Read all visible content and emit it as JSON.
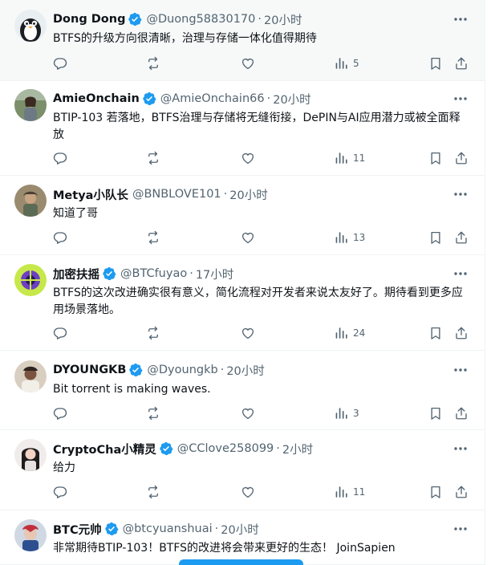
{
  "replies": [
    {
      "name": "Dong Dong",
      "verified": true,
      "handle": "@Duong58830170",
      "time": "20小时",
      "text": "BTFS的升级方向很清晰，治理与存储一体化值得期待",
      "views": "5",
      "highlighted": true
    },
    {
      "name": "AmieOnchain",
      "verified": true,
      "handle": "@AmieOnchain66",
      "time": "20小时",
      "text": "BTIP-103 若落地，BTFS治理与存储将无缝衔接，DePIN与AI应用潜力或被全面释放",
      "views": "11",
      "highlighted": false
    },
    {
      "name": "Metya小队长",
      "verified": false,
      "handle": "@BNBLOVE101",
      "time": "20小时",
      "text": "知道了哥",
      "views": "13",
      "highlighted": false
    },
    {
      "name": "加密扶摇",
      "verified": true,
      "handle": "@BTCfuyao",
      "time": "17小时",
      "text": "BTFS的这次改进确实很有意义，简化流程对开发者来说太友好了。期待看到更多应用场景落地。",
      "views": "24",
      "highlighted": false
    },
    {
      "name": "DYOUNGKB",
      "verified": true,
      "handle": "@Dyoungkb",
      "time": "20小时",
      "text": "Bit torrent is making waves.",
      "views": "3",
      "highlighted": false
    },
    {
      "name": "CryptoCha小精灵",
      "verified": true,
      "handle": "@CClove258099",
      "time": "2小时",
      "text": "给力",
      "views": "11",
      "highlighted": false
    },
    {
      "name": "BTC元帅",
      "verified": true,
      "handle": "@btcyuanshuai",
      "time": "20小时",
      "text": "非常期待BTIP-103！BTFS的改进将会带来更好的生态！ JoinSapien",
      "views": "",
      "highlighted": false
    }
  ],
  "colors": {
    "verified_badge": "#1d9bf0",
    "icon_gray": "#536471",
    "highlight_bg": "#f7f9f9",
    "divider": "#eff3f4"
  },
  "icons": {
    "verified": "verified-badge-icon",
    "more": "more-icon",
    "reply": "reply-icon",
    "retweet": "retweet-icon",
    "like": "like-icon",
    "views": "views-icon",
    "bookmark": "bookmark-icon",
    "share": "share-icon"
  }
}
